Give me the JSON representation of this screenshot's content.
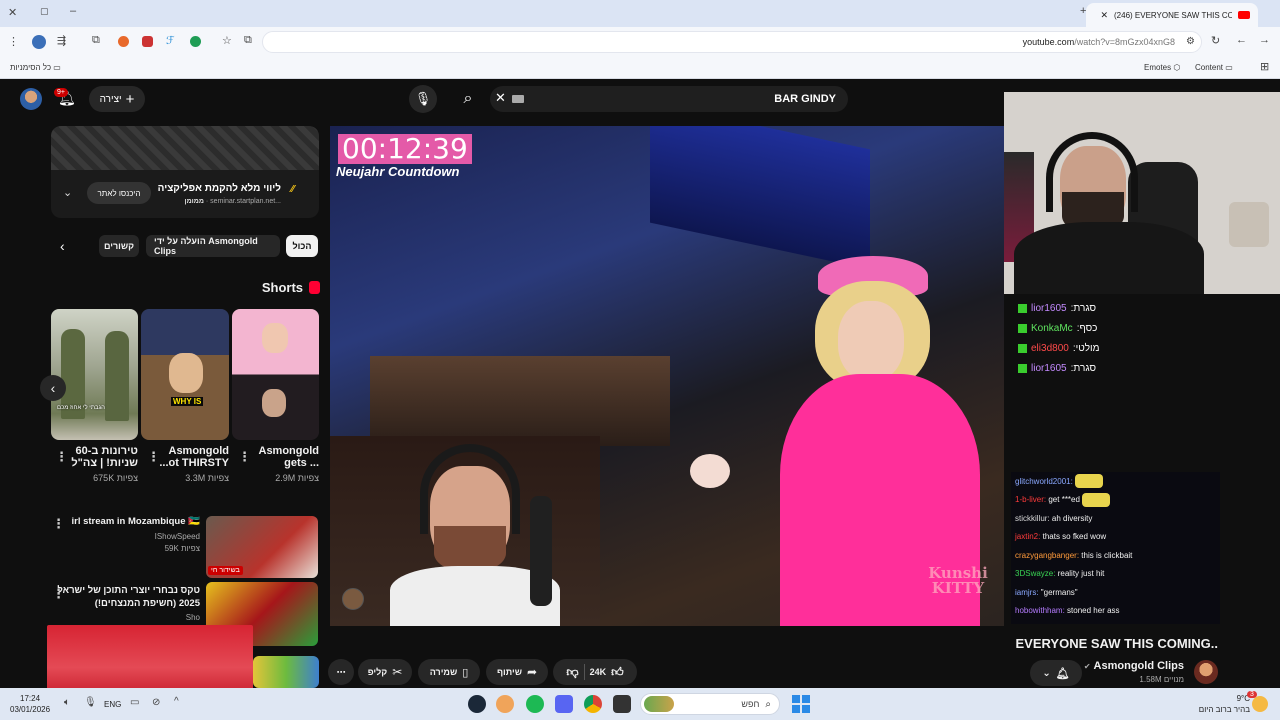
{
  "browser": {
    "tab_title": "(246) EVERYONE SAW THIS CO",
    "url_host": "youtube.com",
    "url_path": "/watch?v=8mGzx04xnG8",
    "bookmarks_right": "כל הסימניות",
    "bookmarks_emotes": "Emotes",
    "bookmarks_content": "Content"
  },
  "header": {
    "notif_count": "9+",
    "create_label": "יצירה",
    "search_value": "BAR GINDY"
  },
  "ad": {
    "title": "ליווי מלא להקמת אפליקציה",
    "sponsor_label": "ממומן",
    "domain": "seminar.startplan.net...",
    "cta": "היכנסו לאתר"
  },
  "chips": [
    "הכול",
    "הועלה על ידי Asmongold Clips",
    "קשורים"
  ],
  "shorts": {
    "title": "Shorts",
    "items": [
      {
        "title_line1": "Asmongold",
        "title_line2": "gets ...",
        "views": "2.9M צפיות"
      },
      {
        "title_line1": "Asmongold",
        "title_line2": "...ot THIRSTY",
        "views": "3.3M צפיות"
      },
      {
        "title_line1": "טירונות ב-60",
        "title_line2": "שניות! | צה\"ל",
        "views": "675K צפיות"
      }
    ],
    "thumb_text_why": "WHY IS",
    "thumb_text_caption": "הגבתי לי אחוז מכם"
  },
  "related": [
    {
      "title": "irl stream in Mozambique 🇲🇿",
      "channel": "IShowSpeed",
      "meta": "59K צפיות",
      "live_badge": "בשידור חי"
    },
    {
      "title": "טקס נבחרי יוצרי התוכן של ישראל 2025 (חשיפת המנצחים!)",
      "channel": "Sho",
      "meta": ""
    }
  ],
  "video": {
    "overlay_timer": "00:12:39",
    "overlay_caption": "Neujahr Countdown",
    "title": "EVERYONE SAW THIS COMING..",
    "channel": "Asmongold Clips",
    "subs": "1.58M מנויים",
    "likes": "24K",
    "share": "שיתוף",
    "save": "שמירה",
    "clip": "קליפ",
    "more": "⋯",
    "watermark": "Kunshi KITTY"
  },
  "he_chat": [
    {
      "user": "lior1605",
      "text": ":סגרת",
      "color": "#c48bff"
    },
    {
      "user": "KonkaMc",
      "text": ":כסף",
      "color": "#5fe35f"
    },
    {
      "user": "eli3d800",
      "text": ":מולטי",
      "color": "#ff4a4a"
    },
    {
      "user": "lior1605",
      "text": ":סגרת",
      "color": "#c48bff"
    }
  ],
  "chat": [
    {
      "user": "glitchworld2001:",
      "text": "",
      "color": "#8aa8ff"
    },
    {
      "user": "1-b-liver:",
      "text": "get ***ed",
      "color": "#ff3b3b"
    },
    {
      "user": "stickkillur:",
      "text": "ah diversity",
      "color": "#d9d9d9"
    },
    {
      "user": "jaxtin2:",
      "text": "thats so fked wow",
      "color": "#ff3b3b"
    },
    {
      "user": "crazygangbanger:",
      "text": "this is clickbait",
      "color": "#ff9b3b"
    },
    {
      "user": "3DSwayze:",
      "text": "reality just hit",
      "color": "#39d353"
    },
    {
      "user": "iamjrs:",
      "text": "\"germans\"",
      "color": "#8aa8ff"
    },
    {
      "user": "hobowithham:",
      "text": "stoned her ass",
      "color": "#b57cff"
    }
  ],
  "taskbar": {
    "search_label": "חפש",
    "lang": "ENG",
    "time": "17:24",
    "date": "03/01/2026",
    "weather_temp": "9°C",
    "weather_desc": "בהיר ברוב היום",
    "weather_badge": "3"
  },
  "colors": {
    "accent_red": "#ff0033",
    "overlay_pink": "#e45aa8",
    "taskbar_bg": "#dfe7f3"
  }
}
